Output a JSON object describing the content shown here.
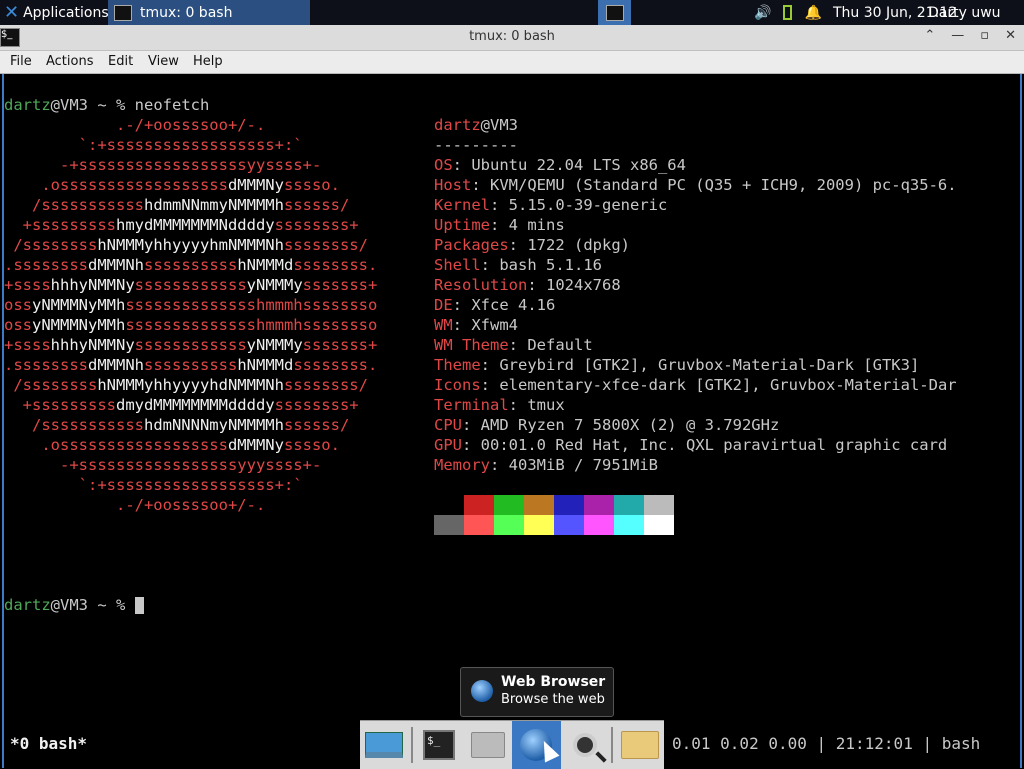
{
  "top_panel": {
    "applications_label": "Applications",
    "task_label": "tmux: 0 bash",
    "clock": "Thu 30 Jun, 21:12",
    "user": "Darty uwu"
  },
  "window": {
    "title": "tmux: 0 bash",
    "menu": [
      "File",
      "Actions",
      "Edit",
      "View",
      "Help"
    ]
  },
  "terminal": {
    "prompt_user": "dartz",
    "prompt_host": "@VM3",
    "prompt_rest": " ~ % ",
    "command": "neofetch",
    "ascii_logo": [
      "            .-/+oossssoo+/-.",
      "        `:+ssssssssssssssssss+:`",
      "      -+ssssssssssssssssssyyssss+-",
      "    .ossssssssssssssssssdMMMNysssso.",
      "   /ssssssssssshdmmNNmmyNMMMMhssssss/",
      "  +ssssssssshmydMMMMMMMNddddyssssssss+",
      " /sssssssshNMMMyhhyyyyhmNMMMNhssssssss/",
      ".ssssssssdMMMNhsssssssssshNMMMdssssssss.",
      "+sssshhhyNMMNyssssssssssssyNMMMysssssss+",
      "ossyNMMMNyMMhsssssssssssssshmmmhssssssso",
      "ossyNMMMNyMMhsssssssssssssshmmmhssssssso",
      "+sssshhhyNMMNyssssssssssssyNMMMysssssss+",
      ".ssssssssdMMMNhsssssssssshNMMMdssssssss.",
      " /sssssssshNMMMyhhyyyyhdNMMMNhssssssss/",
      "  +sssssssssdmydMMMMMMMMddddyssssssss+",
      "   /ssssssssssshdmNNNNmyNMMMMhssssss/",
      "    .ossssssssssssssssssdMMMNysssso.",
      "      -+sssssssssssssssssyyyssss+-",
      "        `:+ssssssssssssssssss+:`",
      "            .-/+oossssoo+/-."
    ],
    "info_user": "dartz",
    "info_host": "@VM3",
    "separator": "---------",
    "info": [
      {
        "key": "OS",
        "value": "Ubuntu 22.04 LTS x86_64"
      },
      {
        "key": "Host",
        "value": "KVM/QEMU (Standard PC (Q35 + ICH9, 2009) pc-q35-6."
      },
      {
        "key": "Kernel",
        "value": "5.15.0-39-generic"
      },
      {
        "key": "Uptime",
        "value": "4 mins"
      },
      {
        "key": "Packages",
        "value": "1722 (dpkg)"
      },
      {
        "key": "Shell",
        "value": "bash 5.1.16"
      },
      {
        "key": "Resolution",
        "value": "1024x768"
      },
      {
        "key": "DE",
        "value": "Xfce 4.16"
      },
      {
        "key": "WM",
        "value": "Xfwm4"
      },
      {
        "key": "WM Theme",
        "value": "Default"
      },
      {
        "key": "Theme",
        "value": "Greybird [GTK2], Gruvbox-Material-Dark [GTK3]"
      },
      {
        "key": "Icons",
        "value": "elementary-xfce-dark [GTK2], Gruvbox-Material-Dar"
      },
      {
        "key": "Terminal",
        "value": "tmux"
      },
      {
        "key": "CPU",
        "value": "AMD Ryzen 7 5800X (2) @ 3.792GHz"
      },
      {
        "key": "GPU",
        "value": "00:01.0 Red Hat, Inc. QXL paravirtual graphic card"
      },
      {
        "key": "Memory",
        "value": "403MiB / 7951MiB"
      }
    ],
    "palette_top": [
      "#000000",
      "#cc2222",
      "#22bb22",
      "#bb7722",
      "#2222bb",
      "#aa22aa",
      "#22aaaa",
      "#bbbbbb"
    ],
    "palette_bottom": [
      "#666666",
      "#ff5555",
      "#55ff55",
      "#ffff55",
      "#5555ff",
      "#ff55ff",
      "#55ffff",
      "#ffffff"
    ]
  },
  "tmux_status": {
    "left": "*0 bash*",
    "right": "0.01 0.02 0.00 | 21:12:01 | bash"
  },
  "tooltip": {
    "title": "Web Browser",
    "subtitle": "Browse the web"
  }
}
